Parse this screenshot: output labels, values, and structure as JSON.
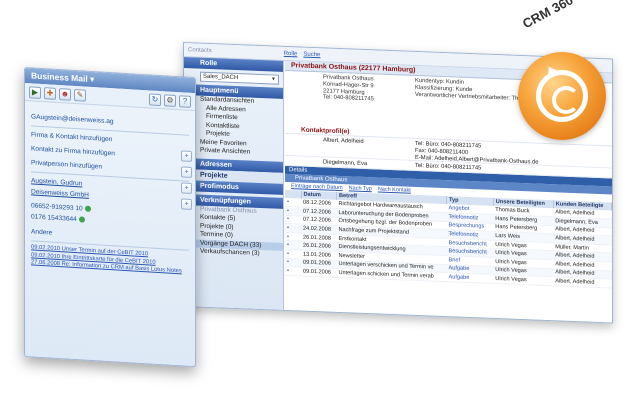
{
  "badge": {
    "text": "CRM 360°",
    "accent": "#f39a2b"
  },
  "crm_window": {
    "top_bar": {
      "title": "Contacts",
      "links": [
        "Rolle",
        "Suche"
      ]
    },
    "left": {
      "role_header": "Rolle",
      "role_select": "Sales_DACH",
      "hauptmenu": "Hauptmenü",
      "tree": [
        "Standardansichten",
        "Alle Adressen",
        "Firmenliste",
        "Kontaktliste",
        "Projekte",
        "Meine Favoriten",
        "Private Ansichten"
      ],
      "sections": [
        "Adressen",
        "Projekte",
        "Profimodus",
        "Verknüpfungen"
      ],
      "links_title": "Privatbank Osthaus",
      "links": [
        "Kontakte (5)",
        "Projekte (0)",
        "Termine (0)",
        "Vorgänge DACH (33)",
        "Verkaufschancen (3)"
      ]
    },
    "firm": {
      "title": "Privatbank Osthaus (22177 Hamburg)",
      "address": [
        "Privatbank Osthaus",
        "Konrad-Hager-Str 9",
        "22177 Hamburg",
        "Tel: 040-808211745"
      ],
      "meta": [
        "Kundentyp: Kundin",
        "Klassifizierung: Kunde",
        "Verantwortlicher Vertriebsmitarbeiter: Thomas"
      ]
    },
    "kontakt_header": "Kontaktprofil(e)",
    "persons": [
      {
        "name": "Albert, Adelheid",
        "info": [
          "Tel: Büro: 040-808211745",
          "Fax: 040-808211400",
          "E-Mail: Adelheid.Albert@Privatbank-Osthaus.de"
        ]
      },
      {
        "name": "Diegelmann, Eva",
        "info": [
          "Tel: Büro: 040-808211745"
        ]
      }
    ],
    "details_tab": "Details",
    "firm_sub": "Privatbank Osthaus",
    "tools": [
      "Einträge nach Datum",
      "Nach Typ",
      "Nach Kontakt"
    ],
    "table": {
      "headers": [
        "",
        "Datum",
        "Betreff",
        "Typ",
        "Unsere Beteiligten",
        "Kunden Beteiligte"
      ],
      "rows": [
        [
          "▪",
          "08.12.2006",
          "Richtangebot Hardwareaustausch",
          "Angebot",
          "Thomas Buck",
          "Albert, Adelheid"
        ],
        [
          "▪",
          "07.12.2006",
          "Laborunteruchung der Bodenproben",
          "Telefonnotiz",
          "Hans Petersberg",
          "Diegelmann, Eva"
        ],
        [
          "▪",
          "07.12.2006",
          "Ortsbegehung bzgl. der Bodenproben",
          "Besprechungs",
          "Hans Petersberg",
          "Albert, Adelheid"
        ],
        [
          "▪",
          "24.02.2008",
          "Nachfrage zum Projektstand",
          "Telefonnotiz",
          "Lars Weis",
          "Albert, Adelheid"
        ],
        [
          "▪",
          "26.01.2008",
          "Erstkontakt",
          "Besuchsbericht",
          "Ulrich Vegas",
          "Müller, Martin"
        ],
        [
          "▪",
          "26.01.2006",
          "Dienstleistungsentwicklung",
          "Besuchsbericht",
          "Ulrich Vegas",
          "Albert, Adelheid"
        ],
        [
          "▪",
          "13.01.2006",
          "Newsletter",
          "Brief",
          "Ulrich Vegas",
          "Albert, Adelheid"
        ],
        [
          "▪",
          "09.01.2006",
          "Unterlagen verschicken und Termin ve",
          "Aufgabe",
          "Ulrich Vegas",
          "Albert, Adelheid"
        ],
        [
          "▪",
          "09.01.2006",
          "Unterlagen schicken und Termin verab",
          "Aufgabe",
          "Ulrich Vegas",
          "Albert, Adelheid"
        ]
      ]
    }
  },
  "sidebar": {
    "title": "Business Mail ▾",
    "email": "GAugstein@deisenweiss.ag",
    "actions": [
      "Firma & Kontakt hinzufügen",
      "Kontakt zu Firma hinzufügen",
      "Privatperson hinzufügen"
    ],
    "person": "Augstein, Gudrun",
    "company": "Deisenweiss GmbH",
    "phones": [
      "06652-919293 10",
      "0176 15433644"
    ],
    "other": "Andere",
    "links": [
      "09.02.2010  Unser Termin auf der CeBIT 2010",
      "09.02.2010  Ihre Eintrittskarte für die CeBIT 2010",
      "27.06.2008  Re: Information zu CRM auf Basis Lotus Notes"
    ]
  }
}
